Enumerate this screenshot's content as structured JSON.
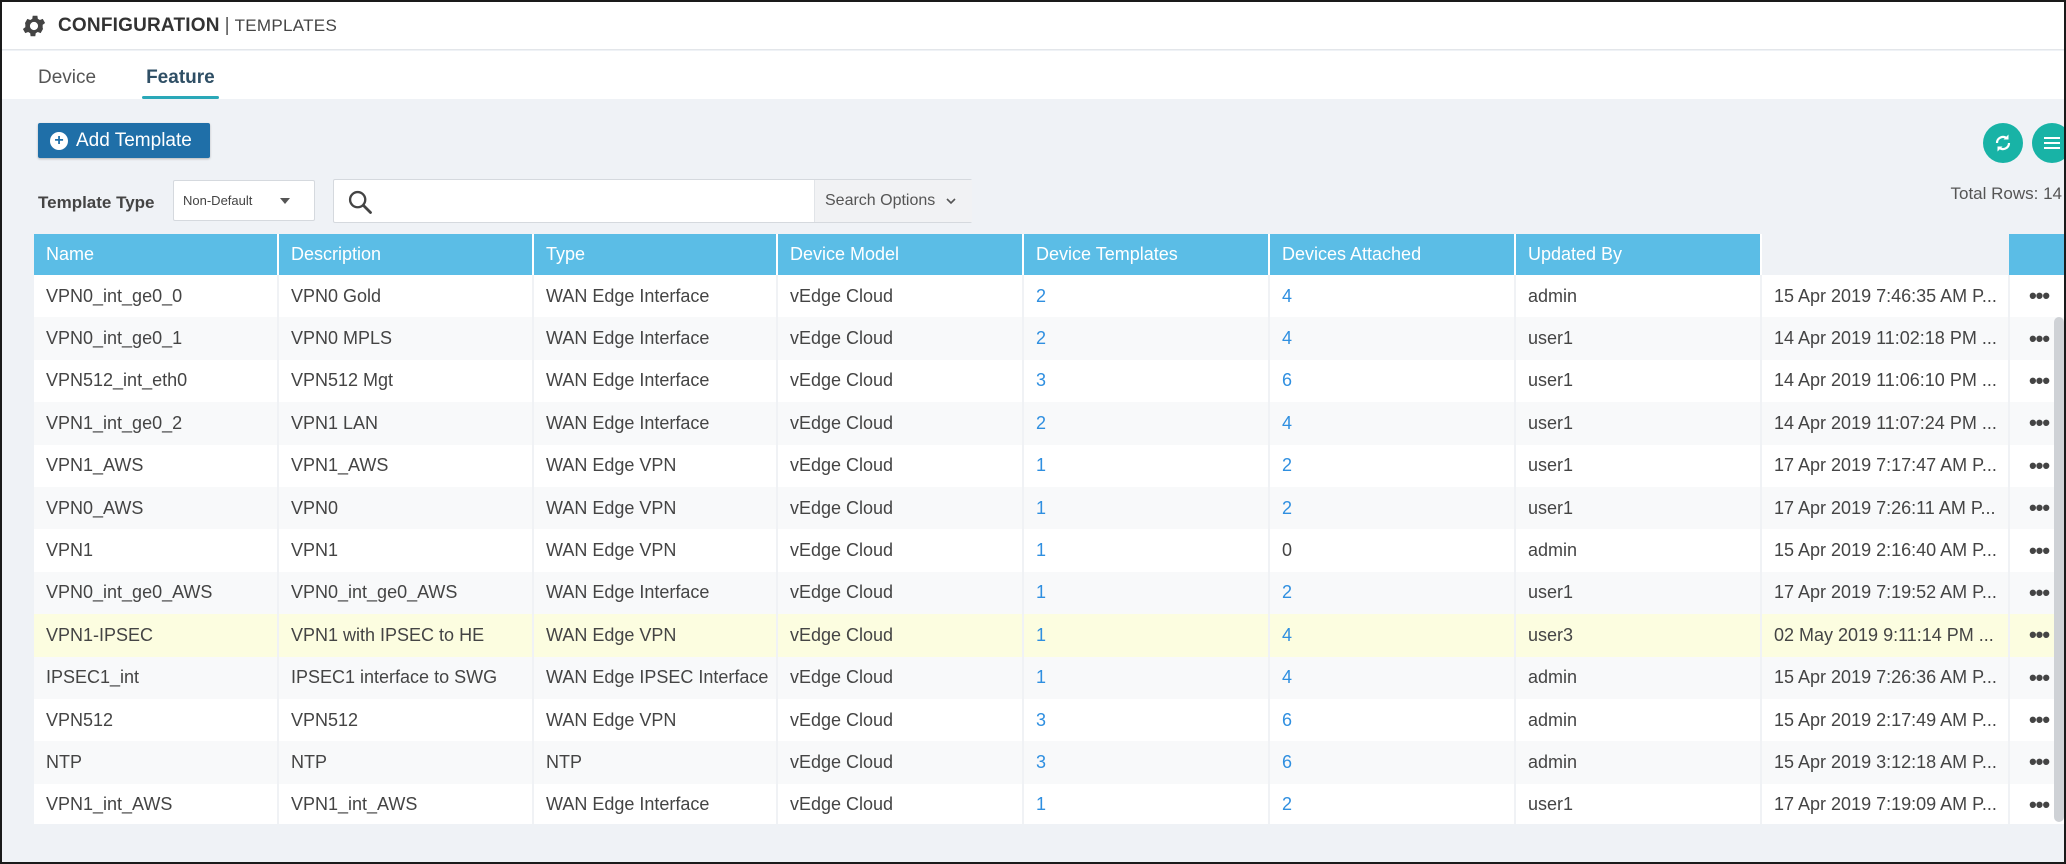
{
  "header": {
    "title_main": "CONFIGURATION",
    "title_sep": "|",
    "title_sub": "TEMPLATES",
    "icon": "gear-icon"
  },
  "tabs": [
    {
      "label": "Device",
      "active": false
    },
    {
      "label": "Feature",
      "active": true
    }
  ],
  "toolbar": {
    "add_label": "Add Template",
    "refresh_icon": "refresh-icon",
    "menu_icon": "hamburger-menu-icon"
  },
  "filter": {
    "template_type_label": "Template Type",
    "template_type_value": "Non-Default",
    "search_placeholder": "",
    "search_options_label": "Search Options",
    "total_rows": "Total Rows: 14"
  },
  "colors": {
    "accent": "#1f6fa8",
    "header_blue": "#5bbde6",
    "teal": "#18b3a6",
    "link": "#2f8fe0",
    "highlight_row": "#fcfde0"
  },
  "table": {
    "columns": [
      "Name",
      "Description",
      "Type",
      "Device Model",
      "Device Templates",
      "Devices Attached",
      "Updated By",
      "",
      ""
    ],
    "rows": [
      {
        "name": "VPN0_int_ge0_0",
        "description": "VPN0 Gold",
        "type": "WAN Edge Interface",
        "model": "vEdge Cloud",
        "device_templates": "2",
        "devices_attached": "4",
        "updated_by": "admin",
        "updated": "15 Apr 2019 7:46:35 AM P...",
        "highlight": false
      },
      {
        "name": "VPN0_int_ge0_1",
        "description": "VPN0 MPLS",
        "type": "WAN Edge Interface",
        "model": "vEdge Cloud",
        "device_templates": "2",
        "devices_attached": "4",
        "updated_by": "user1",
        "updated": "14 Apr 2019 11:02:18 PM ...",
        "highlight": false
      },
      {
        "name": "VPN512_int_eth0",
        "description": "VPN512 Mgt",
        "type": "WAN Edge Interface",
        "model": "vEdge Cloud",
        "device_templates": "3",
        "devices_attached": "6",
        "updated_by": "user1",
        "updated": "14 Apr 2019 11:06:10 PM ...",
        "highlight": false
      },
      {
        "name": "VPN1_int_ge0_2",
        "description": "VPN1 LAN",
        "type": "WAN Edge Interface",
        "model": "vEdge Cloud",
        "device_templates": "2",
        "devices_attached": "4",
        "updated_by": "user1",
        "updated": "14 Apr 2019 11:07:24 PM ...",
        "highlight": false
      },
      {
        "name": "VPN1_AWS",
        "description": "VPN1_AWS",
        "type": "WAN Edge VPN",
        "model": "vEdge Cloud",
        "device_templates": "1",
        "devices_attached": "2",
        "updated_by": "user1",
        "updated": "17 Apr 2019 7:17:47 AM P...",
        "highlight": false
      },
      {
        "name": "VPN0_AWS",
        "description": "VPN0",
        "type": "WAN Edge VPN",
        "model": "vEdge Cloud",
        "device_templates": "1",
        "devices_attached": "2",
        "updated_by": "user1",
        "updated": "17 Apr 2019 7:26:11 AM P...",
        "highlight": false
      },
      {
        "name": "VPN1",
        "description": "VPN1",
        "type": "WAN Edge VPN",
        "model": "vEdge Cloud",
        "device_templates": "1",
        "devices_attached": "0",
        "updated_by": "admin",
        "updated": "15 Apr 2019 2:16:40 AM P...",
        "highlight": false
      },
      {
        "name": "VPN0_int_ge0_AWS",
        "description": "VPN0_int_ge0_AWS",
        "type": "WAN Edge Interface",
        "model": "vEdge Cloud",
        "device_templates": "1",
        "devices_attached": "2",
        "updated_by": "user1",
        "updated": "17 Apr 2019 7:19:52 AM P...",
        "highlight": false
      },
      {
        "name": "VPN1-IPSEC",
        "description": "VPN1 with IPSEC to HE",
        "type": "WAN Edge VPN",
        "model": "vEdge Cloud",
        "device_templates": "1",
        "devices_attached": "4",
        "updated_by": "user3",
        "updated": "02 May 2019 9:11:14 PM ...",
        "highlight": true
      },
      {
        "name": "IPSEC1_int",
        "description": "IPSEC1 interface to SWG",
        "type": "WAN Edge IPSEC Interface",
        "model": "vEdge Cloud",
        "device_templates": "1",
        "devices_attached": "4",
        "updated_by": "admin",
        "updated": "15 Apr 2019 7:26:36 AM P...",
        "highlight": false
      },
      {
        "name": "VPN512",
        "description": "VPN512",
        "type": "WAN Edge VPN",
        "model": "vEdge Cloud",
        "device_templates": "3",
        "devices_attached": "6",
        "updated_by": "admin",
        "updated": "15 Apr 2019 2:17:49 AM P...",
        "highlight": false
      },
      {
        "name": "NTP",
        "description": "NTP",
        "type": "NTP",
        "model": "vEdge Cloud",
        "device_templates": "3",
        "devices_attached": "6",
        "updated_by": "admin",
        "updated": "15 Apr 2019 3:12:18 AM P...",
        "highlight": false
      },
      {
        "name": "VPN1_int_AWS",
        "description": "VPN1_int_AWS",
        "type": "WAN Edge Interface",
        "model": "vEdge Cloud",
        "device_templates": "1",
        "devices_attached": "2",
        "updated_by": "user1",
        "updated": "17 Apr 2019 7:19:09 AM P...",
        "highlight": false
      }
    ],
    "more_glyph": "•••"
  }
}
